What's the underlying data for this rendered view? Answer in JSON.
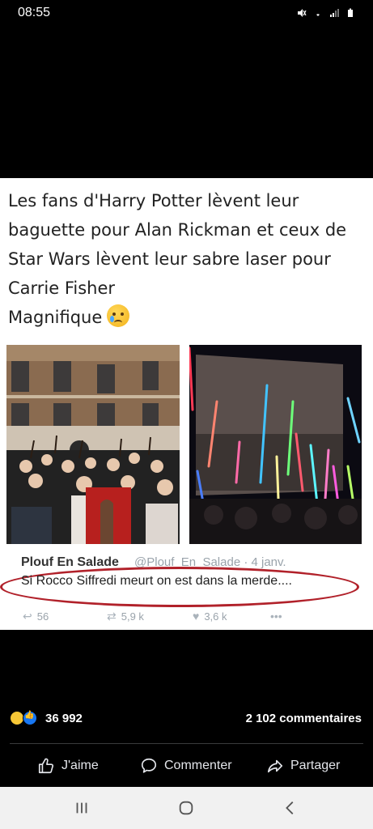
{
  "status_bar": {
    "time": "08:55",
    "icons": [
      "mute-icon",
      "wifi-icon",
      "signal-icon",
      "battery-icon"
    ]
  },
  "post": {
    "lines": [
      "Les fans d'Harry Potter lèvent leur",
      "baguette pour Alan Rickman et ceux de",
      "Star Wars lèvent leur sabre laser pour",
      "Carrie Fisher",
      "Magnifique"
    ],
    "emoji": "crying-face-icon",
    "tweet": {
      "author": "Plouf En Salade",
      "handle": "@Plouf_En_Salade · 4 janv.",
      "body": "Si Rocco Siffredi meurt on est dans la merde....",
      "actions": {
        "reply_count": "56",
        "retweet_count": "5,9 k",
        "like_count": "3,6 k",
        "more": "•••"
      }
    }
  },
  "reactions": {
    "count": "36 992",
    "comments": "2 102 commentaires"
  },
  "actions": {
    "like": "J'aime",
    "comment": "Commenter",
    "share": "Partager"
  },
  "colors": {
    "background": "#000000",
    "ellipse": "#b1212a",
    "like_blue": "#1877f2"
  }
}
